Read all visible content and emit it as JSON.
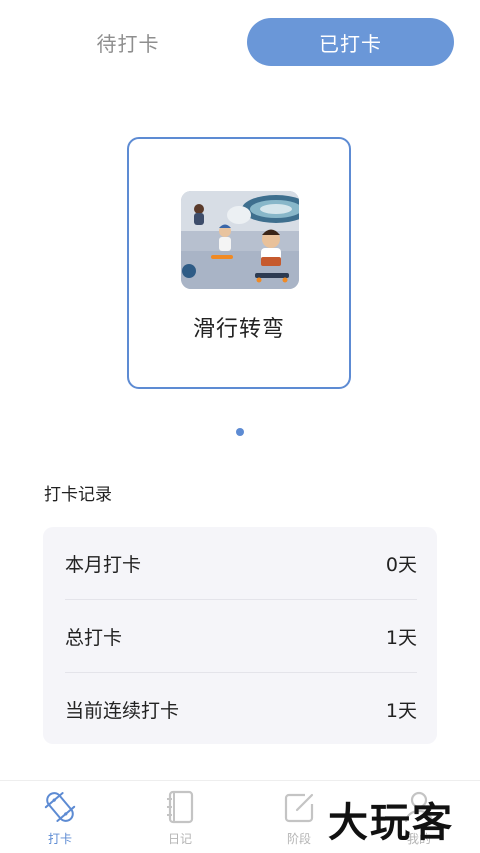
{
  "tabs": {
    "pending_label": "待打卡",
    "done_label": "已打卡"
  },
  "card": {
    "title": "滑行转弯",
    "image_name": "kids-skateboarding-illustration"
  },
  "records": {
    "section_title": "打卡记录",
    "rows": [
      {
        "label": "本月打卡",
        "value": "0天"
      },
      {
        "label": "总打卡",
        "value": "1天"
      },
      {
        "label": "当前连续打卡",
        "value": "1天"
      }
    ]
  },
  "tabbar": {
    "items": [
      {
        "label": "打卡",
        "icon": "skateboard-icon",
        "active": true
      },
      {
        "label": "日记",
        "icon": "diary-icon",
        "active": false
      },
      {
        "label": "阶段",
        "icon": "edit-icon",
        "active": false
      },
      {
        "label": "我的",
        "icon": "user-icon",
        "active": false
      }
    ]
  },
  "watermark": "大玩客",
  "colors": {
    "accent": "#5d8bd3",
    "tab_active_bg": "#6a97d8",
    "panel_bg": "#f5f5f9",
    "inactive": "#b5b5b5"
  }
}
